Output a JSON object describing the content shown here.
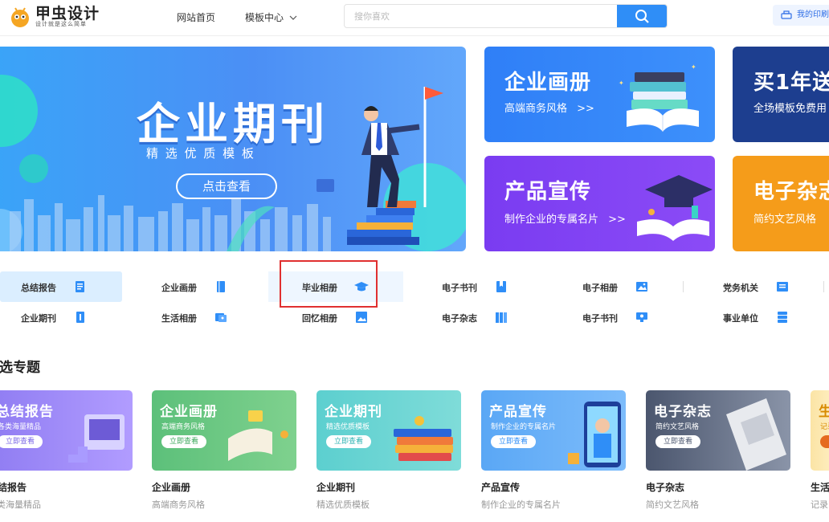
{
  "header": {
    "logo_name": "甲虫设计",
    "logo_slogan": "设计就是这么简单",
    "nav_home": "网站首页",
    "nav_templates": "模板中心",
    "search_placeholder": "搜你喜欢",
    "my_print": "我的印刷"
  },
  "hero": {
    "title": "企业期刊",
    "subtitle": "精 选 优 质 模 板",
    "button": "点击查看"
  },
  "promos": [
    {
      "title": "企业画册",
      "sub": "高端商务风格",
      "arrow": ">>"
    },
    {
      "title": "买1年送",
      "sub": "全场模板免费用"
    },
    {
      "title": "产品宣传",
      "sub": "制作企业的专属名片",
      "arrow": ">>"
    },
    {
      "title": "电子杂志",
      "sub": "简约文艺风格"
    }
  ],
  "categories": [
    {
      "label": "总结报告",
      "icon": "report-icon"
    },
    {
      "label": "企业画册",
      "icon": "book-icon"
    },
    {
      "label": "毕业相册",
      "icon": "graduation-cap-icon"
    },
    {
      "label": "电子书刊",
      "icon": "bookmark-book-icon"
    },
    {
      "label": "电子相册",
      "icon": "image-icon"
    },
    {
      "label": "党务机关",
      "icon": "party-icon"
    },
    {
      "label": "企业期刊",
      "icon": "journal-icon"
    },
    {
      "label": "生活相册",
      "icon": "photos-icon"
    },
    {
      "label": "回忆相册",
      "icon": "picture-icon"
    },
    {
      "label": "电子杂志",
      "icon": "magazine-icon"
    },
    {
      "label": "电子书刊",
      "icon": "monitor-icon"
    },
    {
      "label": "事业单位",
      "icon": "server-icon"
    }
  ],
  "section_title": "精选专题",
  "topics": [
    {
      "card_title": "总结报告",
      "card_sub": "各类海量精品",
      "button": "立即查看",
      "name": "总结报告",
      "desc": "各类海量精品"
    },
    {
      "card_title": "企业画册",
      "card_sub": "高端商务风格",
      "button": "立即查看",
      "name": "企业画册",
      "desc": "高端商务风格"
    },
    {
      "card_title": "企业期刊",
      "card_sub": "精选优质模板",
      "button": "立即查看",
      "name": "企业期刊",
      "desc": "精选优质模板"
    },
    {
      "card_title": "产品宣传",
      "card_sub": "制作企业的专属名片",
      "button": "立即查看",
      "name": "产品宣传",
      "desc": "制作企业的专属名片"
    },
    {
      "card_title": "电子杂志",
      "card_sub": "简约文艺风格",
      "button": "立即查看",
      "name": "电子杂志",
      "desc": "简约文艺风格"
    },
    {
      "card_title": "生活",
      "card_sub": "记录",
      "button": "立",
      "name": "生活",
      "desc": "记录"
    }
  ],
  "colors": {
    "accent": "#2f8ef7",
    "highlight_box": "#e03030",
    "active_category_bg": "#dbeeff"
  }
}
